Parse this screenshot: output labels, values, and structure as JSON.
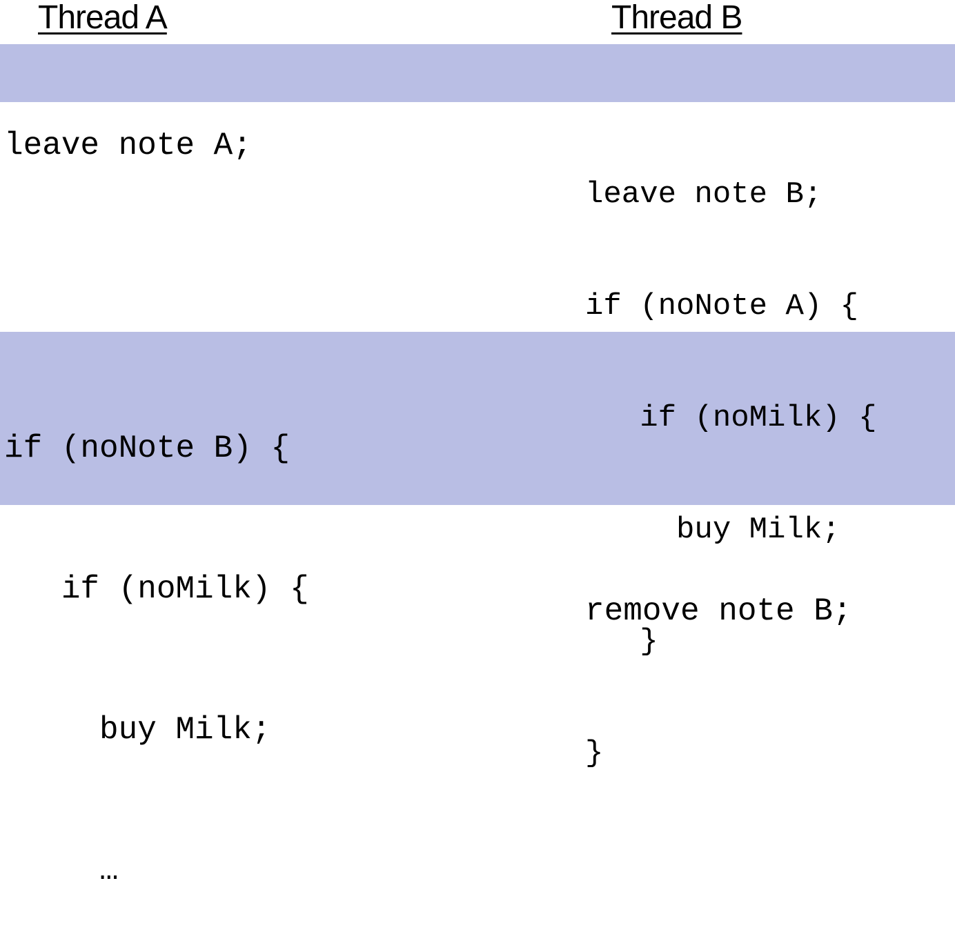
{
  "headers": {
    "thread_a": "Thread A",
    "thread_b": "Thread B"
  },
  "colors": {
    "highlight": "#b9bee4",
    "text": "#000000",
    "background": "#ffffff"
  },
  "thread_a_step1": [
    "leave note A;"
  ],
  "thread_b_step1": [
    "leave note B;",
    "if (noNote A) {",
    "   if (noMilk) {",
    "     buy Milk;",
    "   }",
    "}"
  ],
  "thread_a_step2": [
    "if (noNote B) {",
    "   if (noMilk) {",
    "     buy Milk;",
    "     …"
  ],
  "thread_b_step2": [
    "remove note B;"
  ]
}
